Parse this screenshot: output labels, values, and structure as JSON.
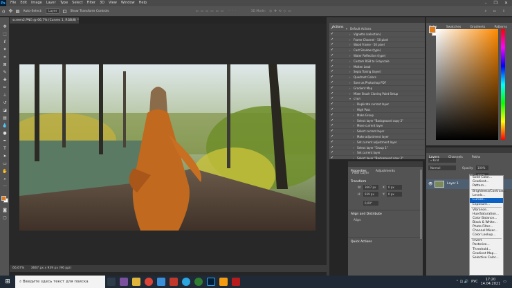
{
  "app": {
    "logo": "Ps",
    "menu": [
      "File",
      "Edit",
      "Image",
      "Layer",
      "Type",
      "Select",
      "Filter",
      "3D",
      "View",
      "Window",
      "Help"
    ],
    "window_buttons": [
      "–",
      "❐",
      "✕"
    ]
  },
  "options_bar": {
    "tool_icon": "move-icon",
    "auto_select_label": "Auto-Select:",
    "auto_select_value": "Layer",
    "transform_label": "Show Transform Controls",
    "mode_3d_label": "3D Mode:"
  },
  "document": {
    "tab_title": "screen2.PNG @ 66,7% (Curves 1, RGB/8) *",
    "status_zoom": "66,67%",
    "status_info": "3667 px x 939 px (96 ppi)"
  },
  "actions_panel": {
    "tab": "Actions",
    "items": [
      {
        "label": "Default Actions",
        "level": 0,
        "expanded": true,
        "folder": true
      },
      {
        "label": "Vignette (selection)",
        "level": 1
      },
      {
        "label": "Frame Channel - 50 pixel",
        "level": 1
      },
      {
        "label": "Wood Frame - 50 pixel",
        "level": 1
      },
      {
        "label": "Cast Shadow (type)",
        "level": 1
      },
      {
        "label": "Water Reflection (type)",
        "level": 1
      },
      {
        "label": "Custom RGB to Grayscale",
        "level": 1
      },
      {
        "label": "Molten Lead",
        "level": 1
      },
      {
        "label": "Sepia Toning (layer)",
        "level": 1
      },
      {
        "label": "Quadrant Colors",
        "level": 1
      },
      {
        "label": "Save as Photoshop PDF",
        "level": 1
      },
      {
        "label": "Gradient Map",
        "level": 1
      },
      {
        "label": "Mixer Brush Cloning Paint Setup",
        "level": 1
      },
      {
        "label": "стил",
        "level": 1,
        "expanded": true
      },
      {
        "label": "Duplicate current layer",
        "level": 2
      },
      {
        "label": "High Pass",
        "level": 2
      },
      {
        "label": "Make Group",
        "level": 2
      },
      {
        "label": "Select layer \"Background copy 2\"",
        "level": 2
      },
      {
        "label": "Move current layer",
        "level": 2
      },
      {
        "label": "Select current layer",
        "level": 2
      },
      {
        "label": "Make adjustment layer",
        "level": 2
      },
      {
        "label": "Set current adjustment layer",
        "level": 2
      },
      {
        "label": "Select layer \"Group 1\"",
        "level": 2
      },
      {
        "label": "Set current layer",
        "level": 2
      },
      {
        "label": "Select layer \"Background copy 2\"",
        "level": 2
      },
      {
        "label": "Duplicate current layer",
        "level": 2
      }
    ]
  },
  "properties_panel": {
    "tabs": [
      "Properties",
      "Adjustments"
    ],
    "layer_type": "Pixel Layer",
    "transform_title": "Transform",
    "w_label": "W:",
    "w_value": "3667 px",
    "h_label": "H:",
    "h_value": "939 px",
    "x_label": "X:",
    "x_value": "0 px",
    "y_label": "Y:",
    "y_value": "0 px",
    "angle_value": "0,00°",
    "align_title": "Align and Distribute",
    "align_label": "Align:",
    "quick_title": "Quick Actions"
  },
  "color_panel": {
    "tabs": [
      "Color",
      "Swatches",
      "Gradients",
      "Patterns"
    ],
    "fg": "#e07b1a",
    "bg": "#ffffff"
  },
  "layers_panel": {
    "tabs": [
      "Layers",
      "Channels",
      "Paths"
    ],
    "filter_label": "Kind",
    "blend_mode": "Normal",
    "opacity_label": "Opacity:",
    "opacity_value": "100%",
    "fill_label": "Fill:",
    "fill_value": "100%",
    "layer_name": "Layer 1"
  },
  "context_menu": {
    "items": [
      {
        "label": "Solid Color..."
      },
      {
        "label": "Gradient..."
      },
      {
        "label": "Pattern..."
      },
      {
        "sep": true
      },
      {
        "label": "Brightness/Contrast..."
      },
      {
        "label": "Levels..."
      },
      {
        "label": "Curves...",
        "highlight": true
      },
      {
        "label": "Exposure..."
      },
      {
        "sep": true
      },
      {
        "label": "Vibrance..."
      },
      {
        "label": "Hue/Saturation..."
      },
      {
        "label": "Color Balance..."
      },
      {
        "label": "Black & White..."
      },
      {
        "label": "Photo Filter..."
      },
      {
        "label": "Channel Mixer..."
      },
      {
        "label": "Color Lookup..."
      },
      {
        "sep": true
      },
      {
        "label": "Invert"
      },
      {
        "label": "Posterize..."
      },
      {
        "label": "Threshold..."
      },
      {
        "label": "Gradient Map..."
      },
      {
        "label": "Selective Color..."
      }
    ]
  },
  "taskbar": {
    "search_placeholder": "Введите здесь текст для поиска",
    "time": "17:20",
    "date": "14.04.2021",
    "lang": "РУС",
    "colors": {
      "bg": "#1f2a36",
      "accent": "#31a8ff"
    }
  }
}
